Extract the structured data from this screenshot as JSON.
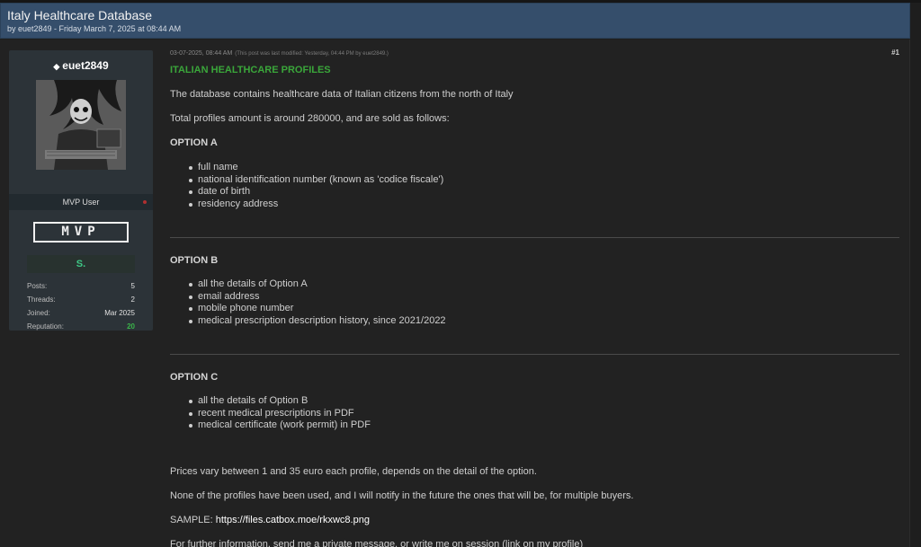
{
  "header": {
    "title": "Italy Healthcare Database",
    "subtitle": "by euet2849 - Friday March 7, 2025 at 08:44 AM"
  },
  "author": {
    "username": "euet2849",
    "user_title": "MVP User",
    "rank_badge": "MVP",
    "s_badge": "S.",
    "stats": [
      {
        "label": "Posts:",
        "value": "5"
      },
      {
        "label": "Threads:",
        "value": "2"
      },
      {
        "label": "Joined:",
        "value": "Mar 2025"
      },
      {
        "label": "Reputation:",
        "value": "20"
      }
    ]
  },
  "post": {
    "date": "03-07-2025, 08:44 AM",
    "modified": "(This post was last modified: Yesterday, 04:44 PM by euet2849.)",
    "number": "#1",
    "headline": "ITALIAN HEALTHCARE PROFILES",
    "intro1": "The database contains healthcare data of Italian citizens from the north of Italy",
    "intro2": "Total profiles amount is around 280000, and are sold as follows:",
    "options": [
      {
        "title": "OPTION A",
        "items": [
          "full name",
          "national identification number (known as 'codice fiscale')",
          "date of birth",
          "residency address"
        ]
      },
      {
        "title": "OPTION B",
        "items": [
          "all the details of Option A",
          "email address",
          "mobile phone number",
          "medical prescription description history, since 2021/2022"
        ]
      },
      {
        "title": "OPTION C",
        "items": [
          "all the details of Option B",
          "recent medical prescriptions in PDF",
          "medical certificate (work permit) in PDF"
        ]
      }
    ],
    "prices": "Prices vary between 1 and 35 euro each profile, depends on the detail of the option.",
    "notify": "None of the profiles have been used, and I will notify in the future the ones that will be, for multiple buyers.",
    "sample_label": "SAMPLE:",
    "sample_link": "https://files.catbox.moe/rkxwc8.png",
    "contact": "For further information, send me a private message, or write me on session (link on my profile)"
  },
  "colors": {
    "header_bg": "#354e6b",
    "headline_green": "#3aa63a",
    "reputation_green": "#3ab54a",
    "s_badge_green": "#3ec886"
  }
}
